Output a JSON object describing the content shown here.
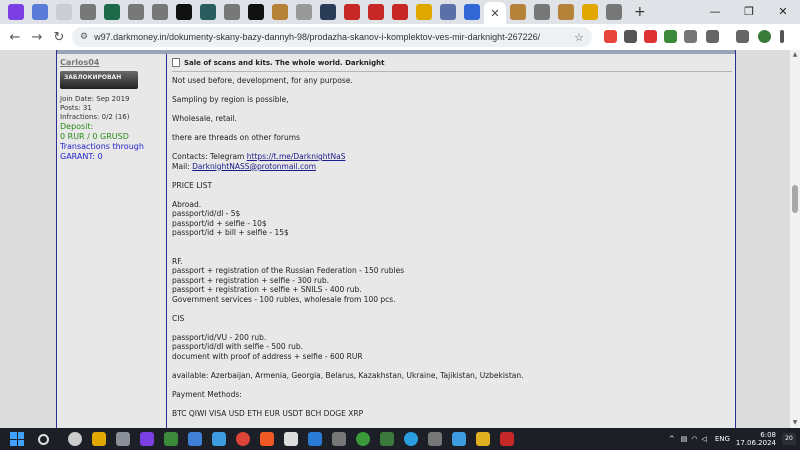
{
  "browser": {
    "tabs_count": 25,
    "window_controls": {
      "minimize": "—",
      "maximize": "❐",
      "close": "✕"
    },
    "new_tab": "+",
    "url": "w97.darkmoney.in/dokumenty-skany-bazy-dannyh-98/prodazha-skanov-i-komplektov-ves-mir-darknight-267226/"
  },
  "user": {
    "username": "Carlos04",
    "badge": "ЗАБЛОКИРОВАН",
    "join_date": "Join Date: Sep 2019",
    "posts": "Posts: 31",
    "infractions": "Infractions: 0/2 (16)",
    "deposit_label": "Deposit:",
    "deposit_value": "0 RUR / 0 GRUSD",
    "transactions_label": "Transactions through",
    "garant": "GARANT: 0"
  },
  "post": {
    "title": "Sale of scans and kits. The whole world. Darknight",
    "lines": {
      "l1": "Not used before, development, for any purpose.",
      "l2": "Sampling by region is possible,",
      "l3": "Wholesale, retail.",
      "l4": "there are threads on other forums",
      "contacts_prefix": "Contacts: Telegram ",
      "contacts_link": "https://t.me/DarknightNaS",
      "mail_prefix": "Mail: ",
      "mail_link": "DarknightNASS@protonmail.com",
      "price_list": "PRICE LIST",
      "abroad": "Abroad.",
      "ab1": "passport/id/dl - 5$",
      "ab2": "passport/id + selfie - 10$",
      "ab3": "passport/id + bill + selfie - 15$",
      "rf": "RF.",
      "rf1": "passport + registration of the Russian Federation - 150 rubles",
      "rf2": "passport + registration + selfie - 300 rub.",
      "rf3": "passport + registration + selfie + SNILS - 400 rub.",
      "rf4": "Government services - 100 rubles, wholesale from 100 pcs.",
      "cis": "CIS",
      "cis1": "passport/id/VU - 200 rub.",
      "cis2": "passport/id/dl with selfie - 500 rub.",
      "cis3": "document with proof of address + selfie - 600 RUR",
      "available": "available: Azerbaijan, Armenia, Georgia, Belarus, Kazakhstan, Ukraine, Tajikistan, Uzbekistan.",
      "payment_label": "Payment Methods:",
      "payment_list": "BTC QIWI VISA USD ETH EUR USDT BCH DOGE XRP"
    }
  },
  "taskbar": {
    "lang": "ENG",
    "time": "6:08",
    "date": "17.06.2024",
    "notifications": "20"
  },
  "colors": {
    "frame_border": "#2d2d9a",
    "deposit_green": "#2a8a1a",
    "transactions_blue": "#2222cc"
  }
}
